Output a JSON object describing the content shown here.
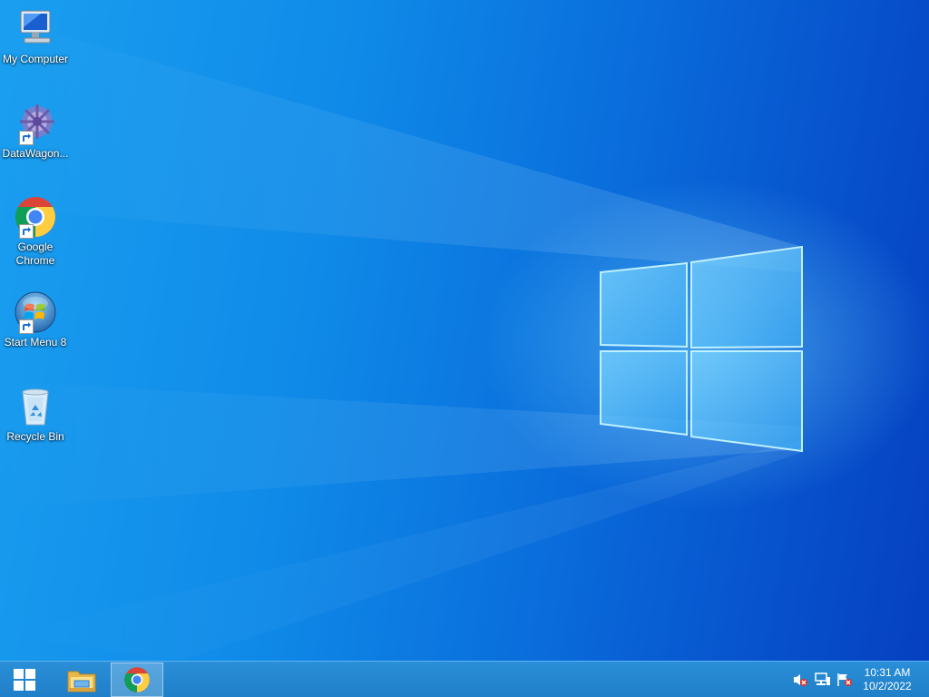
{
  "desktop": {
    "icons": [
      {
        "label": "My Computer",
        "icon": "computer-icon"
      },
      {
        "label": "DataWagon...",
        "icon": "datawagon-icon"
      },
      {
        "label": "Google Chrome",
        "icon": "chrome-icon"
      },
      {
        "label": "Start Menu 8",
        "icon": "start-menu-8-icon"
      },
      {
        "label": "Recycle Bin",
        "icon": "recycle-bin-icon"
      }
    ]
  },
  "taskbar": {
    "start_icon": "windows-logo-icon",
    "pinned": [
      {
        "icon": "file-explorer-icon"
      },
      {
        "icon": "chrome-icon",
        "active": true
      }
    ],
    "tray": {
      "icons": [
        "volume-muted-icon",
        "network-icon",
        "action-center-icon"
      ],
      "time": "10:31 AM",
      "date": "10/2/2022"
    }
  },
  "colors": {
    "accent": "#1f7fc8",
    "desktop": "#0a6fdc"
  }
}
